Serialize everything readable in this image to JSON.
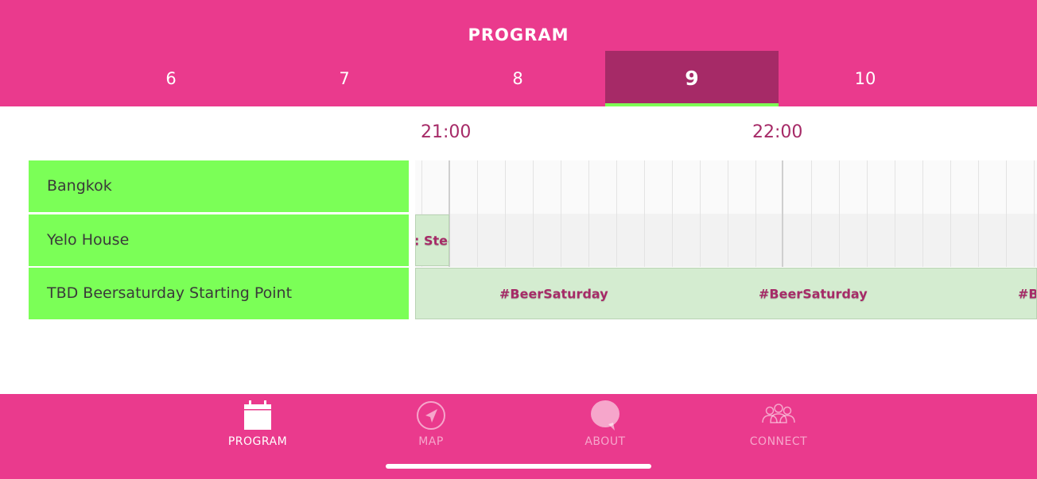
{
  "header": {
    "title": "PROGRAM"
  },
  "days": [
    {
      "label": "6",
      "active": false
    },
    {
      "label": "7",
      "active": false
    },
    {
      "label": "8",
      "active": false
    },
    {
      "label": "9",
      "active": true
    },
    {
      "label": "10",
      "active": false
    }
  ],
  "timeline": {
    "times": [
      "21:00",
      "22:00"
    ]
  },
  "venues": [
    {
      "name": "Bangkok"
    },
    {
      "name": "Yelo House"
    },
    {
      "name": "TBD Beersaturday Starting Point"
    }
  ],
  "events": {
    "yelo": {
      "label": ": Stee"
    },
    "beer": {
      "labels": [
        "#BeerSaturday",
        "#BeerSaturday",
        "#B"
      ]
    }
  },
  "nav": {
    "program": "PROGRAM",
    "map": "MAP",
    "about": "ABOUT",
    "connect": "CONNECT"
  },
  "colors": {
    "brand_pink": "#ea3a8d",
    "active_tab": "#a62a67",
    "venue_green": "#7bff57",
    "event_green": "#d4ecd0",
    "text_accent": "#a62a67"
  }
}
